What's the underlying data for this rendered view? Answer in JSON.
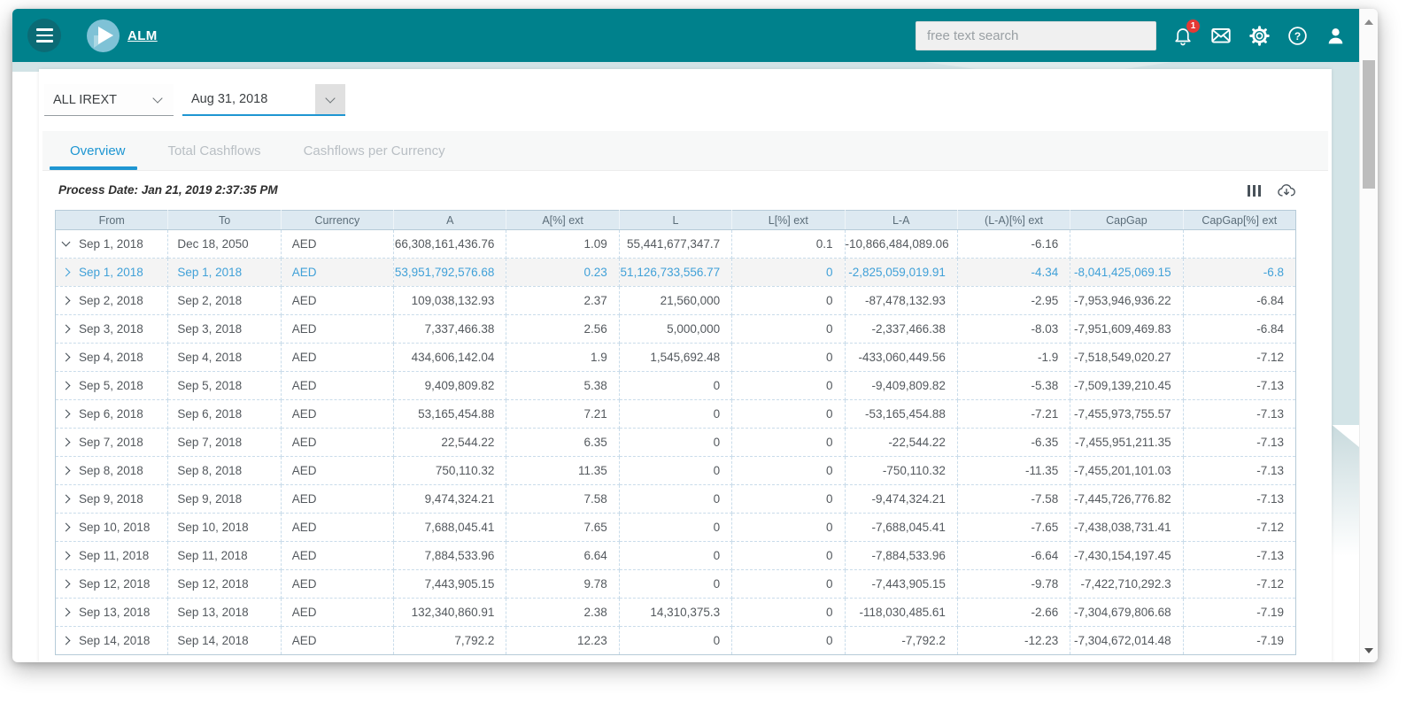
{
  "app_bar": {
    "menu_icon": "hamburger-icon",
    "logo_icon": "play-logo-icon",
    "title": "ALM",
    "search_placeholder": "free text search",
    "notification_count": "1",
    "icons": [
      "notifications-bell-icon",
      "messages-envelope-icon",
      "settings-gear-icon",
      "help-icon",
      "user-profile-icon"
    ]
  },
  "filters": {
    "fund_selector": {
      "value": "ALL IREXT"
    },
    "date_selector": {
      "value": "Aug 31, 2018"
    }
  },
  "tabs": [
    {
      "label": "Overview",
      "active": true
    },
    {
      "label": "Total Cashflows",
      "active": false
    },
    {
      "label": "Cashflows per Currency",
      "active": false
    }
  ],
  "toolbar": {
    "process_date": "Process Date: Jan 21, 2019 2:37:35 PM",
    "icons": [
      "column-chooser-icon",
      "cloud-download-icon"
    ]
  },
  "table": {
    "columns": [
      "From",
      "To",
      "Currency",
      "A",
      "A[%] ext",
      "L",
      "L[%] ext",
      "L-A",
      "(L-A)[%] ext",
      "CapGap",
      "CapGap[%] ext"
    ],
    "rows": [
      {
        "expanded": true,
        "selected": false,
        "from": "Sep 1, 2018",
        "to": "Dec 18, 2050",
        "currency": "AED",
        "values": [
          "66,308,161,436.76",
          "1.09",
          "55,441,677,347.7",
          "0.1",
          "-10,866,484,089.06",
          "-6.16",
          "",
          ""
        ]
      },
      {
        "expanded": false,
        "selected": true,
        "from": "Sep 1, 2018",
        "to": "Sep 1, 2018",
        "currency": "AED",
        "values": [
          "53,951,792,576.68",
          "0.23",
          "51,126,733,556.77",
          "0",
          "-2,825,059,019.91",
          "-4.34",
          "-8,041,425,069.15",
          "-6.8"
        ]
      },
      {
        "expanded": false,
        "selected": false,
        "from": "Sep 2, 2018",
        "to": "Sep 2, 2018",
        "currency": "AED",
        "values": [
          "109,038,132.93",
          "2.37",
          "21,560,000",
          "0",
          "-87,478,132.93",
          "-2.95",
          "-7,953,946,936.22",
          "-6.84"
        ]
      },
      {
        "expanded": false,
        "selected": false,
        "from": "Sep 3, 2018",
        "to": "Sep 3, 2018",
        "currency": "AED",
        "values": [
          "7,337,466.38",
          "2.56",
          "5,000,000",
          "0",
          "-2,337,466.38",
          "-8.03",
          "-7,951,609,469.83",
          "-6.84"
        ]
      },
      {
        "expanded": false,
        "selected": false,
        "from": "Sep 4, 2018",
        "to": "Sep 4, 2018",
        "currency": "AED",
        "values": [
          "434,606,142.04",
          "1.9",
          "1,545,692.48",
          "0",
          "-433,060,449.56",
          "-1.9",
          "-7,518,549,020.27",
          "-7.12"
        ]
      },
      {
        "expanded": false,
        "selected": false,
        "from": "Sep 5, 2018",
        "to": "Sep 5, 2018",
        "currency": "AED",
        "values": [
          "9,409,809.82",
          "5.38",
          "0",
          "0",
          "-9,409,809.82",
          "-5.38",
          "-7,509,139,210.45",
          "-7.13"
        ]
      },
      {
        "expanded": false,
        "selected": false,
        "from": "Sep 6, 2018",
        "to": "Sep 6, 2018",
        "currency": "AED",
        "values": [
          "53,165,454.88",
          "7.21",
          "0",
          "0",
          "-53,165,454.88",
          "-7.21",
          "-7,455,973,755.57",
          "-7.13"
        ]
      },
      {
        "expanded": false,
        "selected": false,
        "from": "Sep 7, 2018",
        "to": "Sep 7, 2018",
        "currency": "AED",
        "values": [
          "22,544.22",
          "6.35",
          "0",
          "0",
          "-22,544.22",
          "-6.35",
          "-7,455,951,211.35",
          "-7.13"
        ]
      },
      {
        "expanded": false,
        "selected": false,
        "from": "Sep 8, 2018",
        "to": "Sep 8, 2018",
        "currency": "AED",
        "values": [
          "750,110.32",
          "11.35",
          "0",
          "0",
          "-750,110.32",
          "-11.35",
          "-7,455,201,101.03",
          "-7.13"
        ]
      },
      {
        "expanded": false,
        "selected": false,
        "from": "Sep 9, 2018",
        "to": "Sep 9, 2018",
        "currency": "AED",
        "values": [
          "9,474,324.21",
          "7.58",
          "0",
          "0",
          "-9,474,324.21",
          "-7.58",
          "-7,445,726,776.82",
          "-7.13"
        ]
      },
      {
        "expanded": false,
        "selected": false,
        "from": "Sep 10, 2018",
        "to": "Sep 10, 2018",
        "currency": "AED",
        "values": [
          "7,688,045.41",
          "7.65",
          "0",
          "0",
          "-7,688,045.41",
          "-7.65",
          "-7,438,038,731.41",
          "-7.12"
        ]
      },
      {
        "expanded": false,
        "selected": false,
        "from": "Sep 11, 2018",
        "to": "Sep 11, 2018",
        "currency": "AED",
        "values": [
          "7,884,533.96",
          "6.64",
          "0",
          "0",
          "-7,884,533.96",
          "-6.64",
          "-7,430,154,197.45",
          "-7.13"
        ]
      },
      {
        "expanded": false,
        "selected": false,
        "from": "Sep 12, 2018",
        "to": "Sep 12, 2018",
        "currency": "AED",
        "values": [
          "7,443,905.15",
          "9.78",
          "0",
          "0",
          "-7,443,905.15",
          "-9.78",
          "-7,422,710,292.3",
          "-7.12"
        ]
      },
      {
        "expanded": false,
        "selected": false,
        "from": "Sep 13, 2018",
        "to": "Sep 13, 2018",
        "currency": "AED",
        "values": [
          "132,340,860.91",
          "2.38",
          "14,310,375.3",
          "0",
          "-118,030,485.61",
          "-2.66",
          "-7,304,679,806.68",
          "-7.19"
        ]
      },
      {
        "expanded": false,
        "selected": false,
        "from": "Sep 14, 2018",
        "to": "Sep 14, 2018",
        "currency": "AED",
        "values": [
          "7,792.2",
          "12.23",
          "0",
          "0",
          "-7,792.2",
          "-12.23",
          "-7,304,672,014.48",
          "-7.19"
        ]
      }
    ]
  },
  "colors": {
    "app_bar_teal": "#00818c",
    "accent_blue": "#1e96d2",
    "selected_row_text": "#41a1d8",
    "notification_badge": "#e53935",
    "table_header_bg": "#dde9f1"
  }
}
